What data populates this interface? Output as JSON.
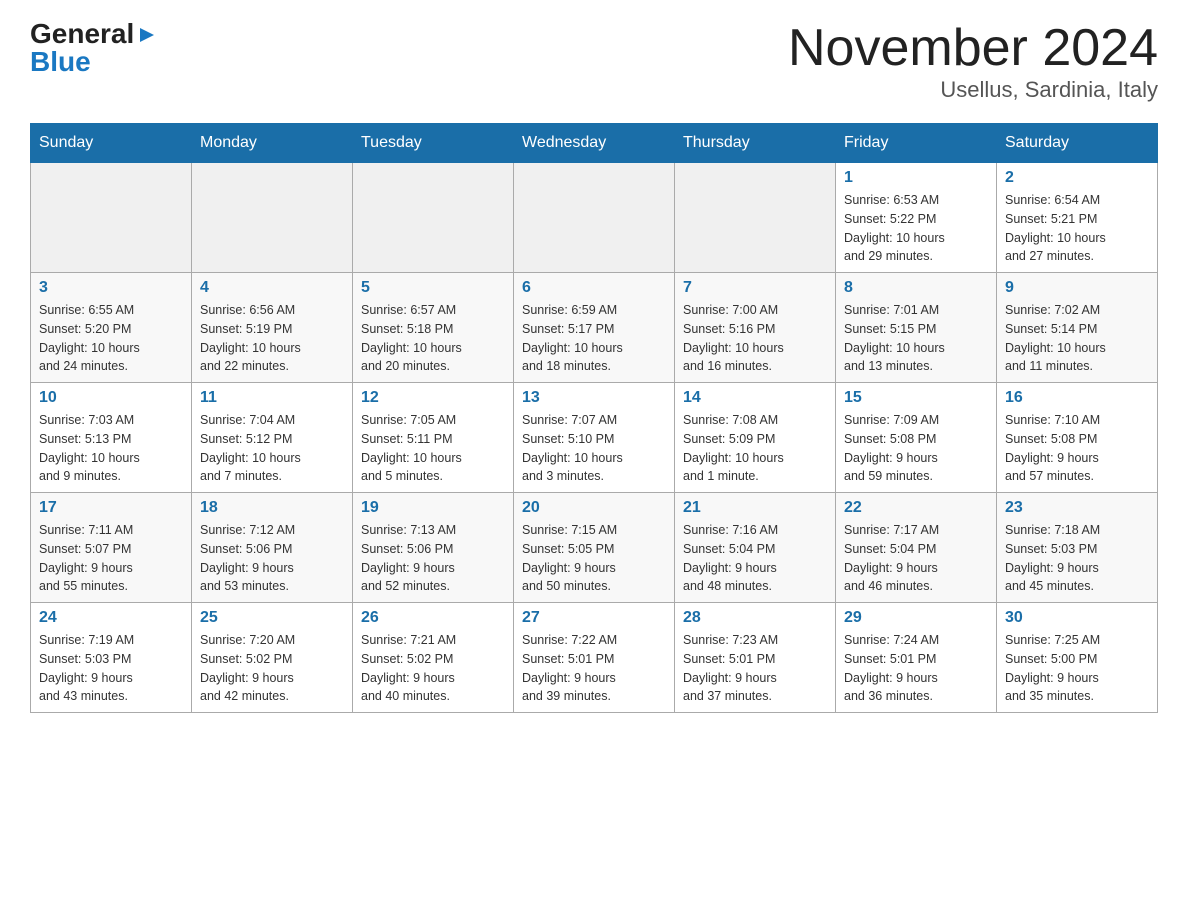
{
  "logo": {
    "general": "General",
    "blue": "Blue",
    "arrow": "▶"
  },
  "title": "November 2024",
  "subtitle": "Usellus, Sardinia, Italy",
  "days_of_week": [
    "Sunday",
    "Monday",
    "Tuesday",
    "Wednesday",
    "Thursday",
    "Friday",
    "Saturday"
  ],
  "weeks": [
    [
      {
        "day": "",
        "info": ""
      },
      {
        "day": "",
        "info": ""
      },
      {
        "day": "",
        "info": ""
      },
      {
        "day": "",
        "info": ""
      },
      {
        "day": "",
        "info": ""
      },
      {
        "day": "1",
        "info": "Sunrise: 6:53 AM\nSunset: 5:22 PM\nDaylight: 10 hours\nand 29 minutes."
      },
      {
        "day": "2",
        "info": "Sunrise: 6:54 AM\nSunset: 5:21 PM\nDaylight: 10 hours\nand 27 minutes."
      }
    ],
    [
      {
        "day": "3",
        "info": "Sunrise: 6:55 AM\nSunset: 5:20 PM\nDaylight: 10 hours\nand 24 minutes."
      },
      {
        "day": "4",
        "info": "Sunrise: 6:56 AM\nSunset: 5:19 PM\nDaylight: 10 hours\nand 22 minutes."
      },
      {
        "day": "5",
        "info": "Sunrise: 6:57 AM\nSunset: 5:18 PM\nDaylight: 10 hours\nand 20 minutes."
      },
      {
        "day": "6",
        "info": "Sunrise: 6:59 AM\nSunset: 5:17 PM\nDaylight: 10 hours\nand 18 minutes."
      },
      {
        "day": "7",
        "info": "Sunrise: 7:00 AM\nSunset: 5:16 PM\nDaylight: 10 hours\nand 16 minutes."
      },
      {
        "day": "8",
        "info": "Sunrise: 7:01 AM\nSunset: 5:15 PM\nDaylight: 10 hours\nand 13 minutes."
      },
      {
        "day": "9",
        "info": "Sunrise: 7:02 AM\nSunset: 5:14 PM\nDaylight: 10 hours\nand 11 minutes."
      }
    ],
    [
      {
        "day": "10",
        "info": "Sunrise: 7:03 AM\nSunset: 5:13 PM\nDaylight: 10 hours\nand 9 minutes."
      },
      {
        "day": "11",
        "info": "Sunrise: 7:04 AM\nSunset: 5:12 PM\nDaylight: 10 hours\nand 7 minutes."
      },
      {
        "day": "12",
        "info": "Sunrise: 7:05 AM\nSunset: 5:11 PM\nDaylight: 10 hours\nand 5 minutes."
      },
      {
        "day": "13",
        "info": "Sunrise: 7:07 AM\nSunset: 5:10 PM\nDaylight: 10 hours\nand 3 minutes."
      },
      {
        "day": "14",
        "info": "Sunrise: 7:08 AM\nSunset: 5:09 PM\nDaylight: 10 hours\nand 1 minute."
      },
      {
        "day": "15",
        "info": "Sunrise: 7:09 AM\nSunset: 5:08 PM\nDaylight: 9 hours\nand 59 minutes."
      },
      {
        "day": "16",
        "info": "Sunrise: 7:10 AM\nSunset: 5:08 PM\nDaylight: 9 hours\nand 57 minutes."
      }
    ],
    [
      {
        "day": "17",
        "info": "Sunrise: 7:11 AM\nSunset: 5:07 PM\nDaylight: 9 hours\nand 55 minutes."
      },
      {
        "day": "18",
        "info": "Sunrise: 7:12 AM\nSunset: 5:06 PM\nDaylight: 9 hours\nand 53 minutes."
      },
      {
        "day": "19",
        "info": "Sunrise: 7:13 AM\nSunset: 5:06 PM\nDaylight: 9 hours\nand 52 minutes."
      },
      {
        "day": "20",
        "info": "Sunrise: 7:15 AM\nSunset: 5:05 PM\nDaylight: 9 hours\nand 50 minutes."
      },
      {
        "day": "21",
        "info": "Sunrise: 7:16 AM\nSunset: 5:04 PM\nDaylight: 9 hours\nand 48 minutes."
      },
      {
        "day": "22",
        "info": "Sunrise: 7:17 AM\nSunset: 5:04 PM\nDaylight: 9 hours\nand 46 minutes."
      },
      {
        "day": "23",
        "info": "Sunrise: 7:18 AM\nSunset: 5:03 PM\nDaylight: 9 hours\nand 45 minutes."
      }
    ],
    [
      {
        "day": "24",
        "info": "Sunrise: 7:19 AM\nSunset: 5:03 PM\nDaylight: 9 hours\nand 43 minutes."
      },
      {
        "day": "25",
        "info": "Sunrise: 7:20 AM\nSunset: 5:02 PM\nDaylight: 9 hours\nand 42 minutes."
      },
      {
        "day": "26",
        "info": "Sunrise: 7:21 AM\nSunset: 5:02 PM\nDaylight: 9 hours\nand 40 minutes."
      },
      {
        "day": "27",
        "info": "Sunrise: 7:22 AM\nSunset: 5:01 PM\nDaylight: 9 hours\nand 39 minutes."
      },
      {
        "day": "28",
        "info": "Sunrise: 7:23 AM\nSunset: 5:01 PM\nDaylight: 9 hours\nand 37 minutes."
      },
      {
        "day": "29",
        "info": "Sunrise: 7:24 AM\nSunset: 5:01 PM\nDaylight: 9 hours\nand 36 minutes."
      },
      {
        "day": "30",
        "info": "Sunrise: 7:25 AM\nSunset: 5:00 PM\nDaylight: 9 hours\nand 35 minutes."
      }
    ]
  ],
  "colors": {
    "header_bg": "#1a6ea8",
    "header_text": "#ffffff",
    "day_number": "#1a6ea8",
    "border": "#aaaaaa"
  }
}
